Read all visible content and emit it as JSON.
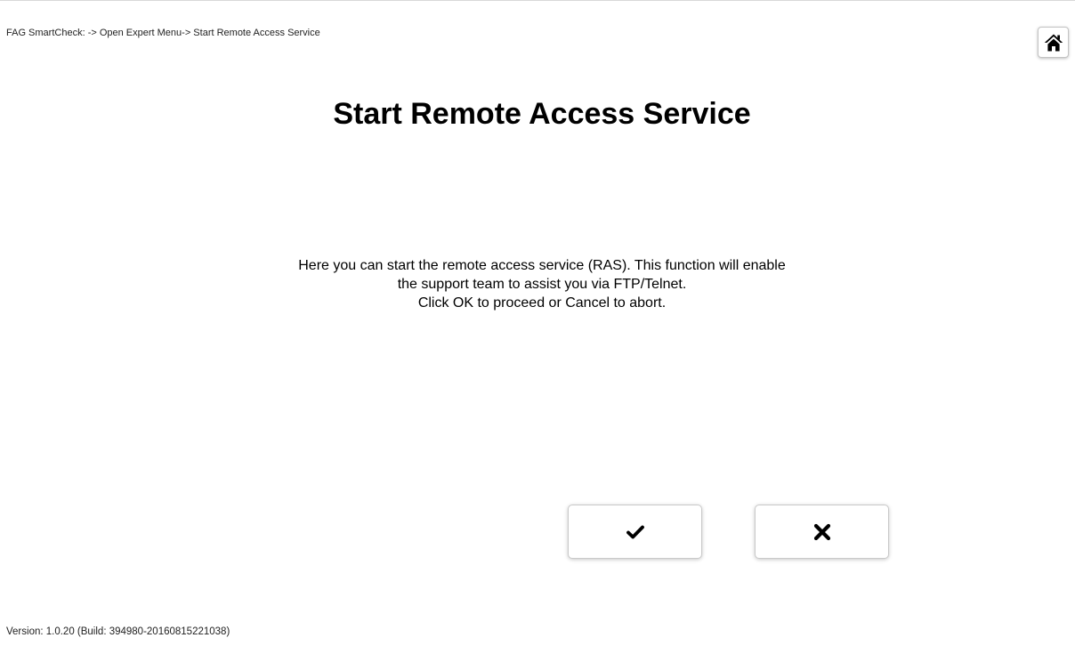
{
  "header": {
    "breadcrumb": "FAG SmartCheck: -> Open Expert Menu-> Start Remote Access Service",
    "home_icon": "home-icon"
  },
  "main": {
    "title": "Start Remote Access Service",
    "message_lines": [
      "Here you can start the remote access service (RAS). This function will enable",
      "the support team to assist you via FTP/Telnet.",
      "Click OK to proceed or Cancel to abort."
    ]
  },
  "actions": {
    "ok_icon": "checkmark-icon",
    "cancel_icon": "close-icon"
  },
  "footer": {
    "version": "Version: 1.0.20 (Build: 394980-20160815221038)"
  },
  "colors": {
    "background": "#ffffff",
    "text": "#000000",
    "button_border": "#c9c9c9"
  }
}
